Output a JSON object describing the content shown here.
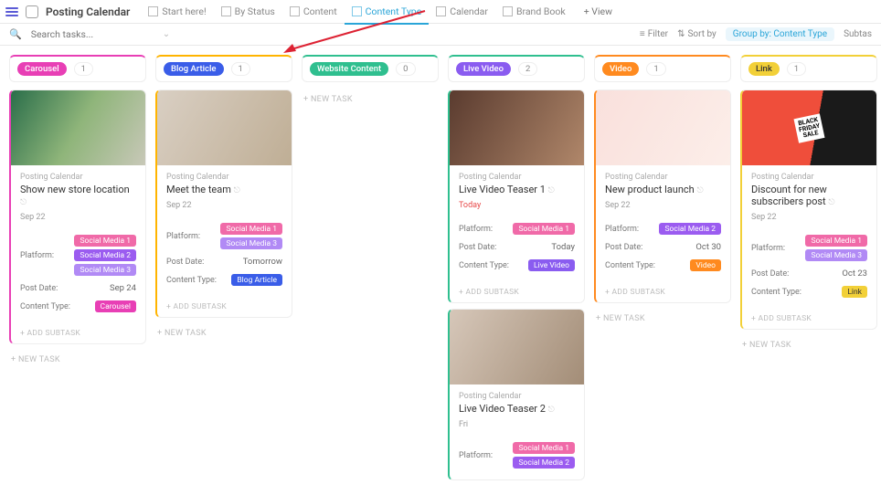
{
  "header": {
    "title": "Posting Calendar",
    "tabs": [
      {
        "label": "Start here!",
        "active": false
      },
      {
        "label": "By Status",
        "active": false
      },
      {
        "label": "Content",
        "active": false
      },
      {
        "label": "Content Type",
        "active": true
      },
      {
        "label": "Calendar",
        "active": false
      },
      {
        "label": "Brand Book",
        "active": false
      }
    ],
    "add_view": "+ View"
  },
  "search": {
    "placeholder": "Search tasks..."
  },
  "toolbar": {
    "filter": "Filter",
    "sort": "Sort by",
    "group": "Group by: Content Type",
    "subtasks": "Subtas"
  },
  "columns": [
    {
      "name": "Carousel",
      "color": "#e83fb5",
      "accent": "#e83fb5",
      "count": "1",
      "cards": [
        {
          "img": "img-a",
          "project": "Posting Calendar",
          "title": "Show new store location",
          "date": "Sep 22",
          "platform_tags": [
            {
              "t": "Social Media 1",
              "c": "#f06aa8"
            },
            {
              "t": "Social Media 2",
              "c": "#9b5cf0"
            },
            {
              "t": "Social Media 3",
              "c": "#b18af5"
            }
          ],
          "post_date": "Sep 24",
          "content_type": {
            "t": "Carousel",
            "c": "#e83fb5"
          },
          "subtask": "+ ADD SUBTASK"
        }
      ],
      "newtask": "+ NEW TASK"
    },
    {
      "name": "Blog Article",
      "color": "#3a5de8",
      "accent": "#ffb400",
      "count": "1",
      "cards": [
        {
          "img": "img-b",
          "project": "Posting Calendar",
          "title": "Meet the team",
          "date": "Sep 22",
          "platform_tags": [
            {
              "t": "Social Media 1",
              "c": "#f06aa8"
            },
            {
              "t": "Social Media 3",
              "c": "#b18af5"
            }
          ],
          "post_date": "Tomorrow",
          "content_type": {
            "t": "Blog Article",
            "c": "#3a5de8"
          },
          "subtask": "+ ADD SUBTASK"
        }
      ],
      "newtask": "+ NEW TASK"
    },
    {
      "name": "Website Content",
      "color": "#2fbf8f",
      "accent": "#2fbf8f",
      "count": "0",
      "cards": [],
      "newtask": "+ NEW TASK"
    },
    {
      "name": "Live Video",
      "color": "#8a5cf0",
      "accent": "#2fbf8f",
      "count": "2",
      "cards": [
        {
          "img": "img-c",
          "project": "Posting Calendar",
          "title": "Live Video Teaser 1",
          "date": "Today",
          "date_today": true,
          "platform_tags": [
            {
              "t": "Social Media 1",
              "c": "#f06aa8"
            }
          ],
          "post_date": "Today",
          "post_date_today": true,
          "content_type": {
            "t": "Live Video",
            "c": "#8a5cf0"
          },
          "subtask": "+ ADD SUBTASK"
        },
        {
          "img": "img-f",
          "project": "Posting Calendar",
          "title": "Live Video Teaser 2",
          "date": "Fri",
          "platform_tags": [
            {
              "t": "Social Media 1",
              "c": "#f06aa8"
            },
            {
              "t": "Social Media 2",
              "c": "#9b5cf0"
            }
          ],
          "post_date": "",
          "content_type": null,
          "subtask": ""
        }
      ],
      "newtask": ""
    },
    {
      "name": "Video",
      "color": "#ff8a1f",
      "accent": "#ff8a1f",
      "count": "1",
      "cards": [
        {
          "img": "img-d",
          "project": "Posting Calendar",
          "title": "New product launch",
          "date": "Sep 22",
          "platform_tags": [
            {
              "t": "Social Media 2",
              "c": "#9b5cf0"
            }
          ],
          "post_date": "Oct 30",
          "content_type": {
            "t": "Video",
            "c": "#ff8a1f"
          },
          "subtask": "+ ADD SUBTASK"
        }
      ],
      "newtask": "+ NEW TASK"
    },
    {
      "name": "Link",
      "color": "#f2d038",
      "accent": "#f2d038",
      "count": "1",
      "text_dark": true,
      "cards": [
        {
          "img": "img-e",
          "project": "Posting Calendar",
          "title": "Discount for new subscribers post",
          "date": "Sep 22",
          "platform_tags": [
            {
              "t": "Social Media 1",
              "c": "#f06aa8"
            },
            {
              "t": "Social Media 3",
              "c": "#b18af5"
            }
          ],
          "post_date": "Oct 23",
          "content_type": {
            "t": "Link",
            "c": "#f2d038",
            "dark": true
          },
          "subtask": "+ ADD SUBTASK",
          "bf": true
        }
      ],
      "newtask": "+ NEW TASK"
    }
  ],
  "labels": {
    "platform": "Platform:",
    "post_date": "Post Date:",
    "content_type": "Content Type:"
  }
}
